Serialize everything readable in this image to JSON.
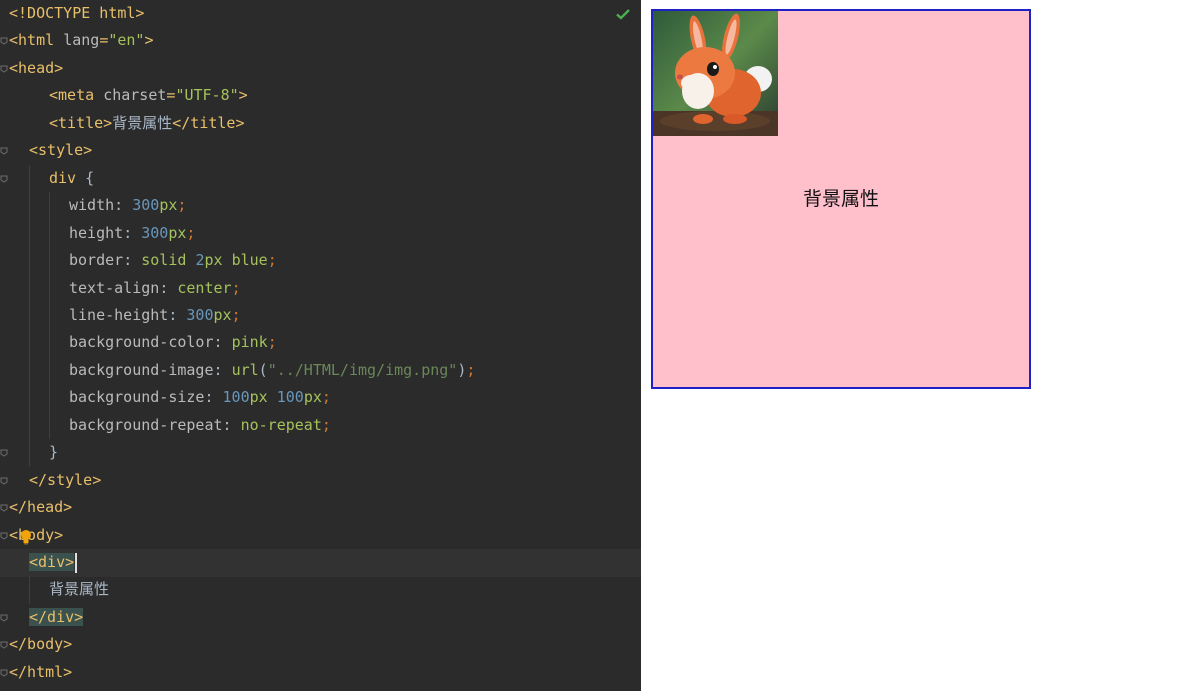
{
  "editor": {
    "lines": [
      {
        "segments": [
          {
            "t": "<!DOCTYPE html>",
            "c": "tag"
          }
        ]
      },
      {
        "segments": [
          {
            "t": "<html ",
            "c": "tag"
          },
          {
            "t": "lang",
            "c": "attr"
          },
          {
            "t": "=",
            "c": "tag"
          },
          {
            "t": "\"en\"",
            "c": "val"
          },
          {
            "t": ">",
            "c": "tag"
          }
        ]
      },
      {
        "segments": [
          {
            "t": "<head>",
            "c": "tag"
          }
        ]
      },
      {
        "segments": [
          {
            "t": "<meta ",
            "c": "tag"
          },
          {
            "t": "charset",
            "c": "attr"
          },
          {
            "t": "=",
            "c": "tag"
          },
          {
            "t": "\"UTF-8\"",
            "c": "val"
          },
          {
            "t": ">",
            "c": "tag"
          }
        ]
      },
      {
        "segments": [
          {
            "t": "<title>",
            "c": "tag"
          },
          {
            "t": "背景属性",
            "c": "plain"
          },
          {
            "t": "</title>",
            "c": "tag"
          }
        ]
      },
      {
        "segments": [
          {
            "t": "<style>",
            "c": "tag"
          }
        ]
      },
      {
        "segments": [
          {
            "t": "div",
            "c": "tag"
          },
          {
            "t": " {",
            "c": "plain"
          }
        ]
      },
      {
        "segments": [
          {
            "t": "width",
            "c": "prop"
          },
          {
            "t": ": ",
            "c": "plain"
          },
          {
            "t": "300",
            "c": "num"
          },
          {
            "t": "px",
            "c": "val"
          },
          {
            "t": ";",
            "c": "sem"
          }
        ]
      },
      {
        "segments": [
          {
            "t": "height",
            "c": "prop"
          },
          {
            "t": ": ",
            "c": "plain"
          },
          {
            "t": "300",
            "c": "num"
          },
          {
            "t": "px",
            "c": "val"
          },
          {
            "t": ";",
            "c": "sem"
          }
        ]
      },
      {
        "segments": [
          {
            "t": "border",
            "c": "prop"
          },
          {
            "t": ": ",
            "c": "plain"
          },
          {
            "t": "solid ",
            "c": "val"
          },
          {
            "t": "2",
            "c": "num"
          },
          {
            "t": "px ",
            "c": "val"
          },
          {
            "t": "blue",
            "c": "val"
          },
          {
            "t": ";",
            "c": "sem"
          }
        ]
      },
      {
        "segments": [
          {
            "t": "text-align",
            "c": "prop"
          },
          {
            "t": ": ",
            "c": "plain"
          },
          {
            "t": "center",
            "c": "val"
          },
          {
            "t": ";",
            "c": "sem"
          }
        ]
      },
      {
        "segments": [
          {
            "t": "line-height",
            "c": "prop"
          },
          {
            "t": ": ",
            "c": "plain"
          },
          {
            "t": "300",
            "c": "num"
          },
          {
            "t": "px",
            "c": "val"
          },
          {
            "t": ";",
            "c": "sem"
          }
        ]
      },
      {
        "segments": [
          {
            "t": "background-color",
            "c": "prop"
          },
          {
            "t": ": ",
            "c": "plain"
          },
          {
            "t": "pink",
            "c": "val"
          },
          {
            "t": ";",
            "c": "sem"
          }
        ]
      },
      {
        "segments": [
          {
            "t": "background-image",
            "c": "prop"
          },
          {
            "t": ": ",
            "c": "plain"
          },
          {
            "t": "url",
            "c": "val"
          },
          {
            "t": "(",
            "c": "plain"
          },
          {
            "t": "\"../HTML/img/img.png\"",
            "c": "str"
          },
          {
            "t": ")",
            "c": "plain"
          },
          {
            "t": ";",
            "c": "sem"
          }
        ]
      },
      {
        "segments": [
          {
            "t": "background-size",
            "c": "prop"
          },
          {
            "t": ": ",
            "c": "plain"
          },
          {
            "t": "100",
            "c": "num"
          },
          {
            "t": "px ",
            "c": "val"
          },
          {
            "t": "100",
            "c": "num"
          },
          {
            "t": "px",
            "c": "val"
          },
          {
            "t": ";",
            "c": "sem"
          }
        ]
      },
      {
        "segments": [
          {
            "t": "background-repeat",
            "c": "prop"
          },
          {
            "t": ": ",
            "c": "plain"
          },
          {
            "t": "no-repeat",
            "c": "val"
          },
          {
            "t": ";",
            "c": "sem"
          }
        ]
      },
      {
        "segments": [
          {
            "t": "}",
            "c": "plain"
          }
        ]
      },
      {
        "segments": [
          {
            "t": "</style>",
            "c": "tag"
          }
        ]
      },
      {
        "segments": [
          {
            "t": "</head>",
            "c": "tag"
          }
        ]
      },
      {
        "segments": [
          {
            "t": "<body>",
            "c": "tag"
          }
        ]
      },
      {
        "segments": [
          {
            "t": "<div>",
            "c": "tag hl"
          }
        ],
        "current": true
      },
      {
        "segments": [
          {
            "t": "背景属性",
            "c": "plain"
          }
        ]
      },
      {
        "segments": [
          {
            "t": "</div>",
            "c": "tag hl"
          }
        ]
      },
      {
        "segments": [
          {
            "t": "</body>",
            "c": "tag"
          }
        ]
      },
      {
        "segments": [
          {
            "t": "</html>",
            "c": "tag"
          }
        ]
      }
    ],
    "check_icon": "checkmark-icon",
    "bulb_icon": "lightbulb-icon"
  },
  "preview": {
    "text": "背景属性",
    "image_icon": "rabbit-image",
    "background_color": "#ffc0cb",
    "border_color": "#2020c8"
  }
}
